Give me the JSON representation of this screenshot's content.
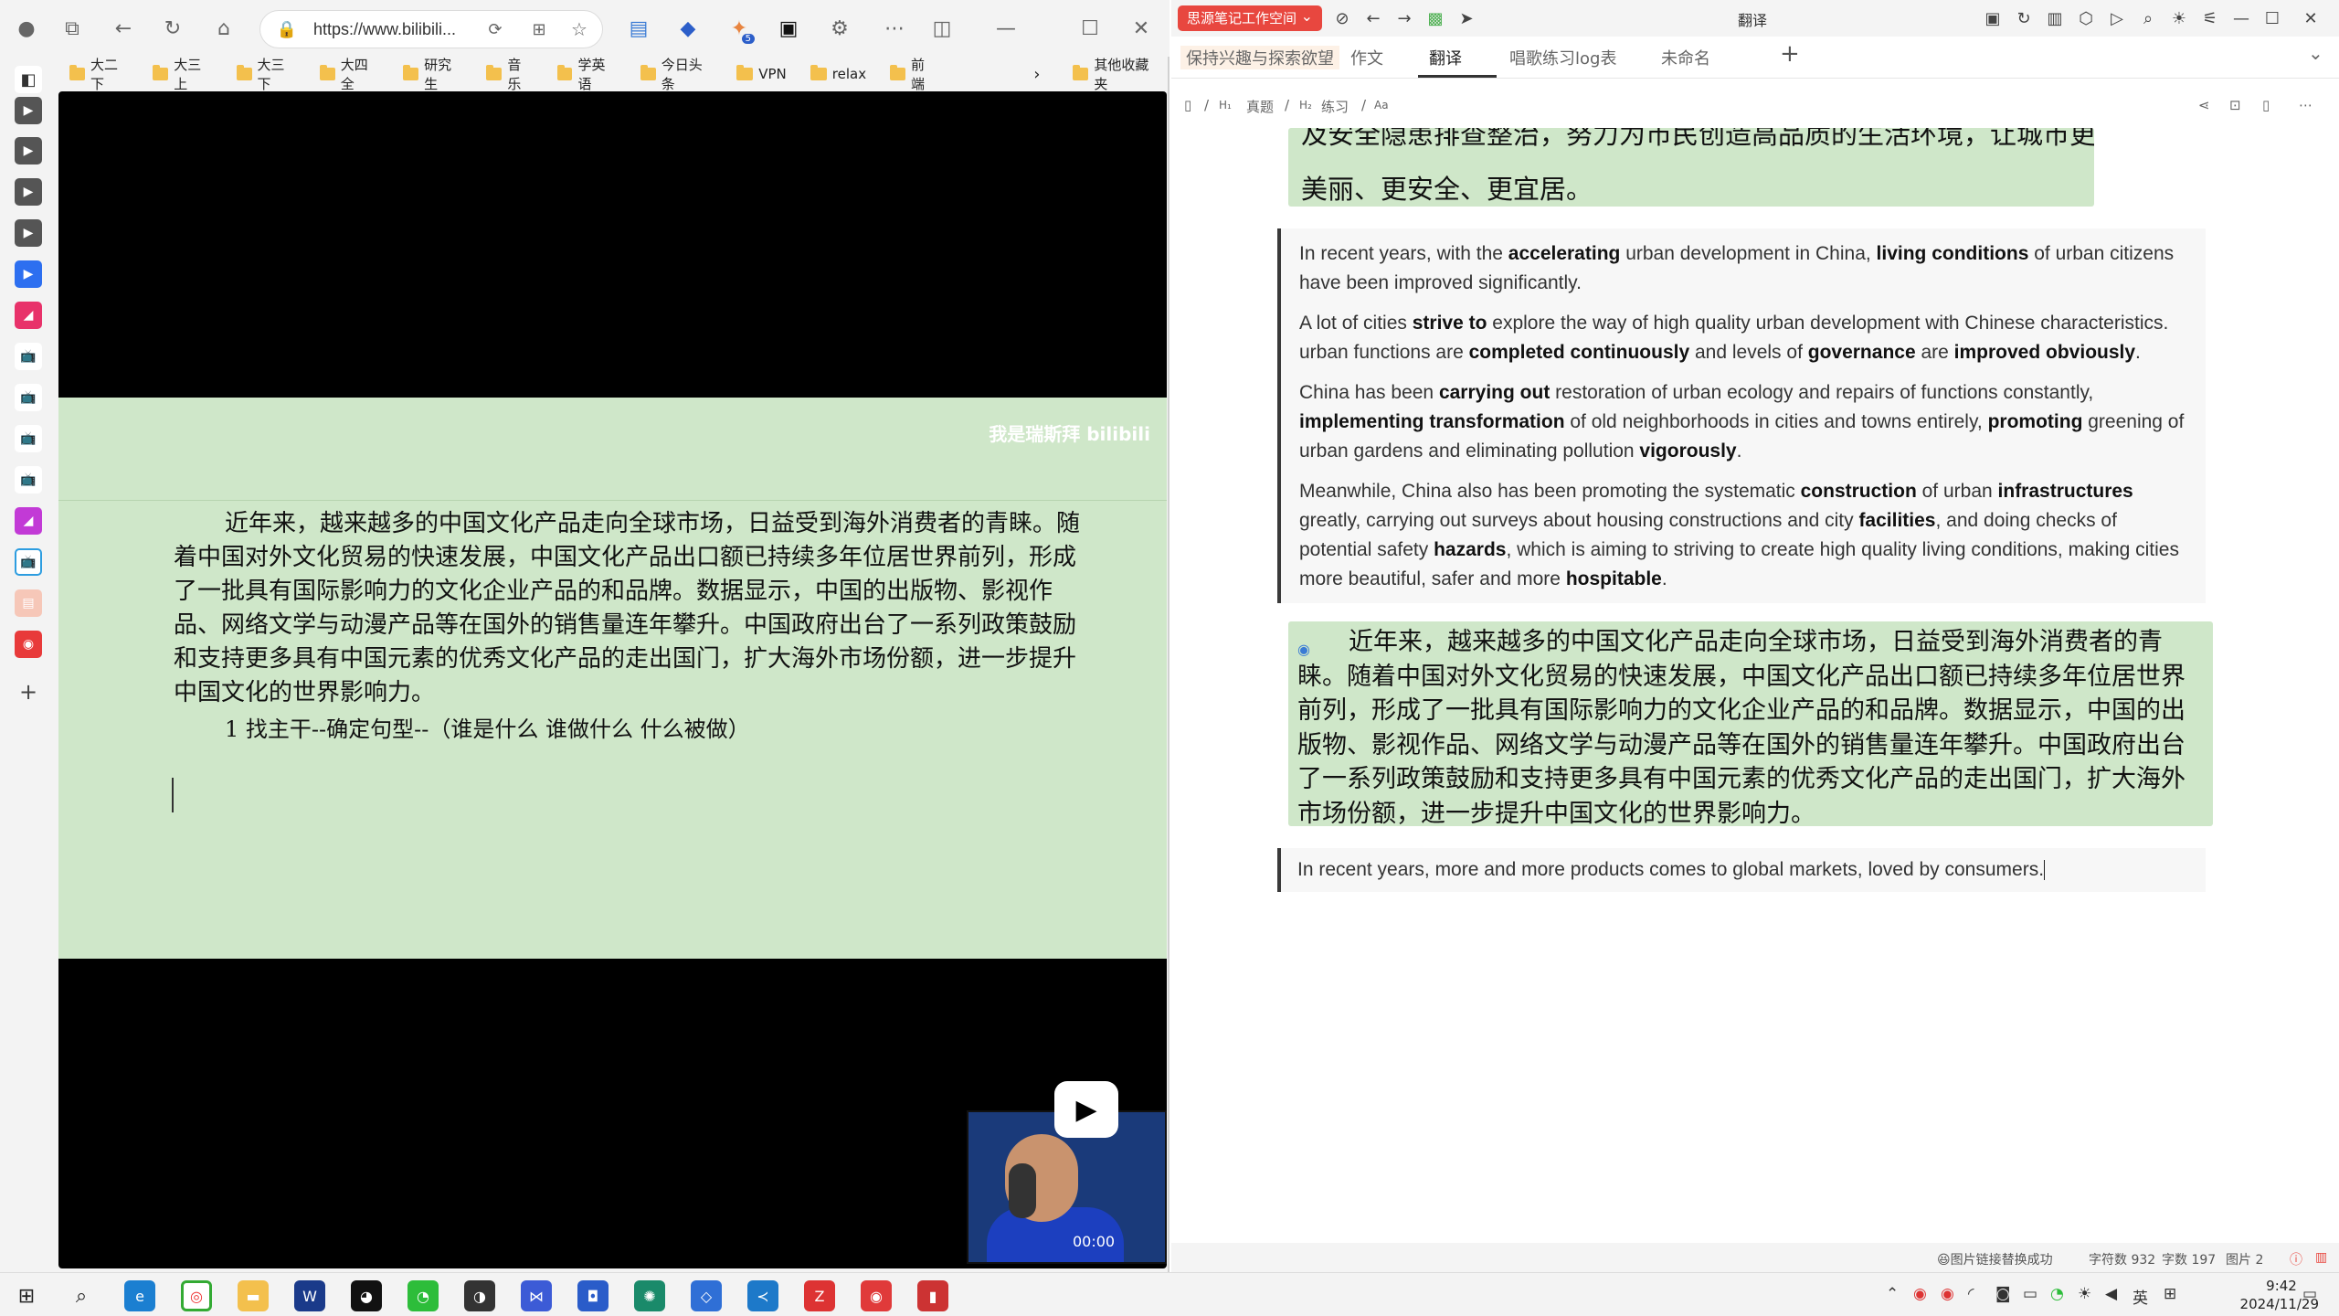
{
  "browser": {
    "url": "https://www.bilibili...",
    "bookmarks": [
      "大二下",
      "大三上",
      "大三下",
      "大四全",
      "研究生",
      "音乐",
      "学英语",
      "今日头条",
      "VPN",
      "relax",
      "前端"
    ],
    "other_bookmarks": "其他收藏夹",
    "extension_badge": "5"
  },
  "video": {
    "watermark": "我是瑞斯拜 bilibili",
    "slide_paragraph": "近年来，越来越多的中国文化产品走向全球市场，日益受到海外消费者的青睐。随着中国对外文化贸易的快速发展，中国文化产品出口额已持续多年位居世界前列，形成了一批具有国际影响力的文化企业产品的和品牌。数据显示，中国的出版物、影视作品、网络文学与动漫产品等在国外的销售量连年攀升。中国政府出台了一系列政策鼓励和支持更多具有中国元素的优秀文化产品的走出国门，扩大海外市场份额，进一步提升中国文化的世界影响力。",
    "slide_note": "1  找主干--确定句型--（谁是什么  谁做什么  什么被做）",
    "pip_time": "00:00"
  },
  "app": {
    "workspace": "思源笔记工作空间",
    "title": "翻译",
    "tabs": [
      "保持兴趣与探索欲望",
      "作文",
      "翻译",
      "唱歌练习log表",
      "未命名"
    ],
    "active_tab": "翻译",
    "breadcrumb": [
      "真题",
      "练习"
    ],
    "top_block_line1": "及安全隐患排查整治，努力为市民创造高品质的生活环境，让城市更",
    "top_block_line2": "美丽、更安全、更宜居。",
    "quote_paragraphs": [
      "In recent years, with the <b>accelerating</b> urban development in China, <b>living conditions</b> of urban citizens have been improved significantly.",
      "A lot of cities <b>strive to</b> explore the way of high quality urban development with Chinese characteristics. urban functions are <b>completed continuously</b> and levels of <b>governance</b> are <b>improved obviously</b>.",
      "China has been <b>carrying out</b> restoration of urban ecology and repairs of functions constantly, <b>implementing transformation</b> of old neighborhoods in cities and towns entirely, <b>promoting</b> greening of urban gardens and eliminating pollution <b>vigorously</b>.",
      "Meanwhile, China also has been promoting the systematic <b>construction</b> of urban <b>infrastructures</b> greatly, carrying out surveys about housing constructions and city <b>facilities</b>, and doing checks of potential safety <b>hazards</b>, which is aiming to striving to create high quality living conditions, making cities more beautiful, safer and more <b>hospitable</b>."
    ],
    "cn_block": "近年来，越来越多的中国文化产品走向全球市场，日益受到海外消费者的青睐。随着中国对外文化贸易的快速发展，中国文化产品出口额已持续多年位居世界前列，形成了一批具有国际影响力的文化企业产品的和品牌。数据显示，中国的出版物、影视作品、网络文学与动漫产品等在国外的销售量连年攀升。中国政府出台了一系列政策鼓励和支持更多具有中国元素的优秀文化产品的走出国门，扩大海外市场份额，进一步提升中国文化的世界影响力。",
    "draft": "In recent years, more and more products comes to global markets, loved by consumers.",
    "status": {
      "notice": "😆图片链接替换成功",
      "char_count": "字符数 932",
      "word_count": "字数 197",
      "image_count": "图片 2"
    }
  },
  "taskbar": {
    "ime": "英",
    "time": "9:42",
    "date": "2024/11/29"
  },
  "colors": {
    "slide_green": "#cfe7c9",
    "workspace_red": "#e8473f",
    "quote_border": "#3a3a3a"
  }
}
